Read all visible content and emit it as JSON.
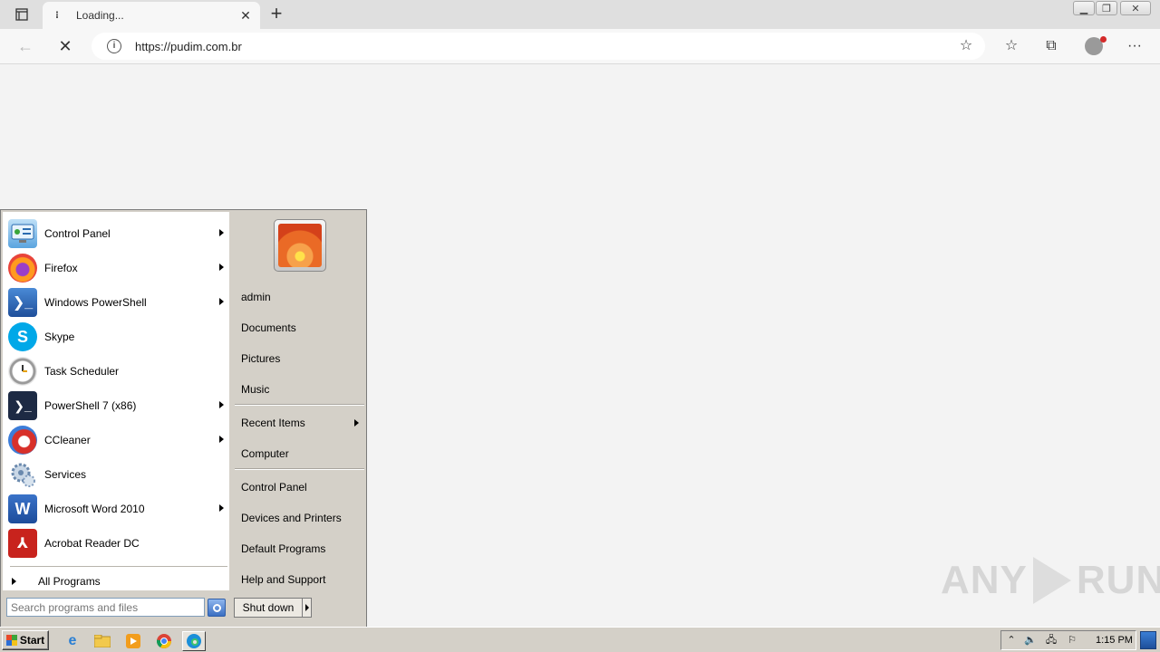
{
  "browser": {
    "tab": {
      "title": "Loading..."
    },
    "address": {
      "url": "https://pudim.com.br"
    }
  },
  "start_menu": {
    "programs": [
      {
        "label": "Control Panel",
        "icon": "control-panel-icon",
        "has_submenu": true
      },
      {
        "label": "Firefox",
        "icon": "firefox-icon",
        "has_submenu": true
      },
      {
        "label": "Windows PowerShell",
        "icon": "powershell-icon",
        "has_submenu": true
      },
      {
        "label": "Skype",
        "icon": "skype-icon",
        "has_submenu": false
      },
      {
        "label": "Task Scheduler",
        "icon": "task-scheduler-icon",
        "has_submenu": false
      },
      {
        "label": "PowerShell 7 (x86)",
        "icon": "powershell7-icon",
        "has_submenu": true
      },
      {
        "label": "CCleaner",
        "icon": "ccleaner-icon",
        "has_submenu": true
      },
      {
        "label": "Services",
        "icon": "services-icon",
        "has_submenu": false
      },
      {
        "label": "Microsoft Word 2010",
        "icon": "word-icon",
        "has_submenu": true
      },
      {
        "label": "Acrobat Reader DC",
        "icon": "acrobat-icon",
        "has_submenu": false
      }
    ],
    "all_programs": "All Programs",
    "right": {
      "user": "admin",
      "documents": "Documents",
      "pictures": "Pictures",
      "music": "Music",
      "recent_items": "Recent Items",
      "computer": "Computer",
      "control_panel": "Control Panel",
      "devices_printers": "Devices and Printers",
      "default_programs": "Default Programs",
      "help_support": "Help and Support"
    },
    "search": {
      "placeholder": "Search programs and files"
    },
    "shutdown": "Shut down"
  },
  "taskbar": {
    "start": "Start",
    "clock": "1:15 PM"
  },
  "watermark": {
    "left": "ANY",
    "right": "RUN"
  },
  "colors": {
    "accent_blue": "#1e62c8",
    "menu_bg": "#d4d0c8"
  }
}
